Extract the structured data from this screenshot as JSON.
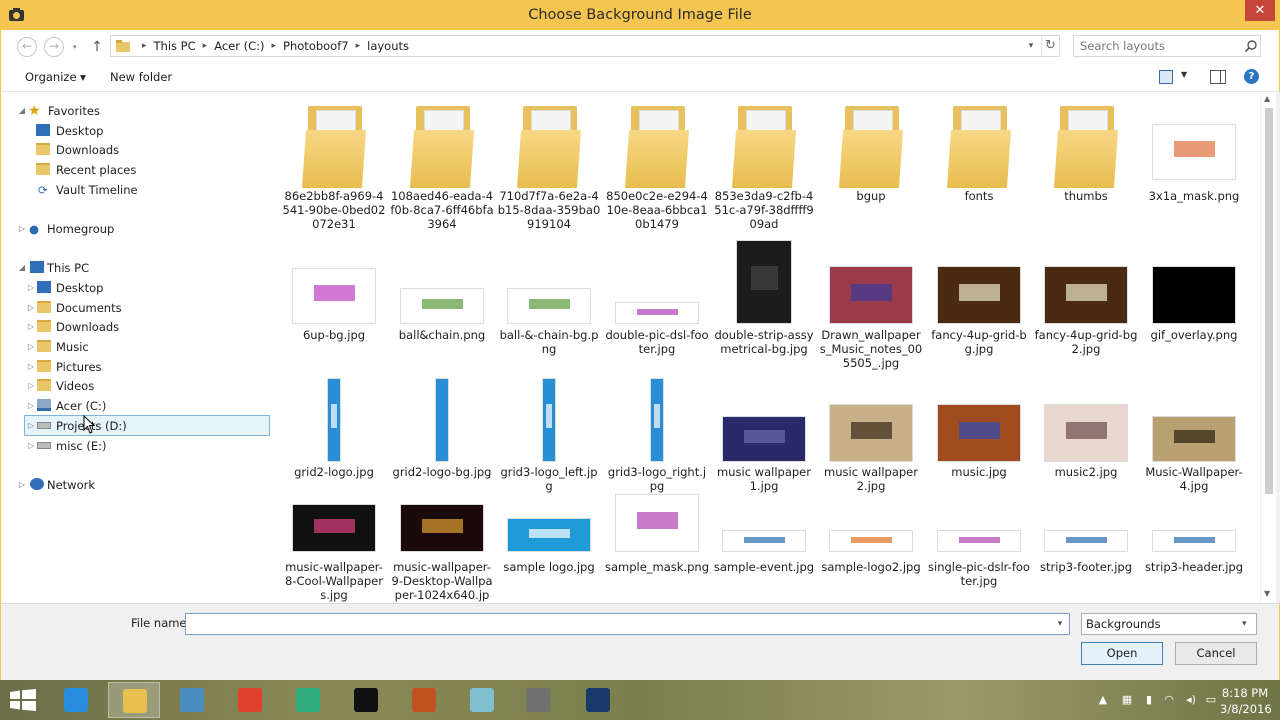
{
  "window": {
    "title": "Choose Background Image File",
    "close_symbol": "✕"
  },
  "address": {
    "crumbs": [
      "This PC",
      "Acer (C:)",
      "Photoboof7",
      "layouts"
    ]
  },
  "search": {
    "placeholder": "Search layouts"
  },
  "toolbar": {
    "organize_label": "Organize ▾",
    "new_folder_label": "New folder"
  },
  "nav": {
    "favorites": {
      "label": "Favorites",
      "items": [
        "Desktop",
        "Downloads",
        "Recent places",
        "Vault Timeline"
      ]
    },
    "homegroup": "Homegroup",
    "this_pc": {
      "label": "This PC",
      "items": [
        "Desktop",
        "Documents",
        "Downloads",
        "Music",
        "Pictures",
        "Videos",
        "Acer (C:)",
        "Projects (D:)",
        "misc (E:)"
      ]
    },
    "network": "Network"
  },
  "files": [
    {
      "name": "86e2bb8f-a969-4541-90be-0bed02072e31",
      "kind": "folder"
    },
    {
      "name": "108aed46-eada-4f0b-8ca7-6ff46bfa3964",
      "kind": "folder"
    },
    {
      "name": "710d7f7a-6e2a-4b15-8daa-359ba0919104",
      "kind": "folder"
    },
    {
      "name": "850e0c2e-e294-410e-8eaa-6bbca10b1479",
      "kind": "folder"
    },
    {
      "name": "853e3da9-c2fb-451c-a79f-38dffff909ad",
      "kind": "folder"
    },
    {
      "name": "bgup",
      "kind": "folder"
    },
    {
      "name": "fonts",
      "kind": "folder"
    },
    {
      "name": "thumbs",
      "kind": "folder"
    },
    {
      "name": "3x1a_mask.png",
      "kind": "image",
      "color": "#ffffff",
      "accent": "#e0703a"
    },
    {
      "name": "6up-bg.jpg",
      "kind": "image",
      "color": "#ffffff",
      "accent": "#c040c0"
    },
    {
      "name": "ball&chain.png",
      "kind": "image",
      "color": "#ffffff",
      "accent": "#5a9a3a"
    },
    {
      "name": "ball-&-chain-bg.png",
      "kind": "image",
      "color": "#ffffff",
      "accent": "#5a9a3a"
    },
    {
      "name": "double-pic-dsl-footer.jpg",
      "kind": "image",
      "color": "#ffffff",
      "accent": "#b040b0"
    },
    {
      "name": "double-strip-assymetrical-bg.jpg",
      "kind": "image",
      "color": "#1c1c1c",
      "accent": "#444444"
    },
    {
      "name": "Drawn_wallpapers_Music_notes_005505_.jpg",
      "kind": "image",
      "color": "#9a3a4a",
      "accent": "#3a3a9a"
    },
    {
      "name": "fancy-4up-grid-bg.jpg",
      "kind": "image",
      "color": "#4a2a12",
      "accent": "#f0e8d0"
    },
    {
      "name": "fancy-4up-grid-bg2.jpg",
      "kind": "image",
      "color": "#4a2a12",
      "accent": "#f0e8d0"
    },
    {
      "name": "gif_overlay.png",
      "kind": "image",
      "color": "#000000",
      "accent": "#000000"
    },
    {
      "name": "grid2-logo.jpg",
      "kind": "image",
      "color": "#2a8ed6",
      "accent": "#ffffff"
    },
    {
      "name": "grid2-logo-bg.jpg",
      "kind": "image",
      "color": "#2a8ed6",
      "accent": "#2a8ed6"
    },
    {
      "name": "grid3-logo_left.jpg",
      "kind": "image",
      "color": "#2a8ed6",
      "accent": "#ffffff"
    },
    {
      "name": "grid3-logo_right.jpg",
      "kind": "image",
      "color": "#2a8ed6",
      "accent": "#ffffff"
    },
    {
      "name": "music wallpaper 1.jpg",
      "kind": "image",
      "color": "#2a2a6a",
      "accent": "#6a6ab0"
    },
    {
      "name": "music wallpaper 2.jpg",
      "kind": "image",
      "color": "#c8b088",
      "accent": "#3a2a1a"
    },
    {
      "name": "music.jpg",
      "kind": "image",
      "color": "#a04a20",
      "accent": "#2a4ab0"
    },
    {
      "name": "music2.jpg",
      "kind": "image",
      "color": "#e8d8d0",
      "accent": "#6a4a4a"
    },
    {
      "name": "Music-Wallpaper-4.jpg",
      "kind": "image",
      "color": "#b8a070",
      "accent": "#2a2010"
    },
    {
      "name": "music-wallpaper-8-Cool-Wallpapers.jpg",
      "kind": "image",
      "color": "#101010",
      "accent": "#e04080"
    },
    {
      "name": "music-wallpaper-9-Desktop-Wallpaper-1024x640.jp",
      "kind": "image",
      "color": "#1a0a0a",
      "accent": "#e0a030"
    },
    {
      "name": "sample logo.jpg",
      "kind": "image",
      "color": "#1e9ad6",
      "accent": "#ffffff"
    },
    {
      "name": "sample_mask.png",
      "kind": "image",
      "color": "#ffffff",
      "accent": "#b040b0"
    },
    {
      "name": "sample-event.jpg",
      "kind": "image",
      "color": "#ffffff",
      "accent": "#2a6ab0"
    },
    {
      "name": "sample-logo2.jpg",
      "kind": "image",
      "color": "#ffffff",
      "accent": "#e07020"
    },
    {
      "name": "single-pic-dslr-footer.jpg",
      "kind": "image",
      "color": "#ffffff",
      "accent": "#b040b0"
    },
    {
      "name": "strip3-footer.jpg",
      "kind": "image",
      "color": "#ffffff",
      "accent": "#2a6ab0"
    },
    {
      "name": "strip3-header.jpg",
      "kind": "image",
      "color": "#ffffff",
      "accent": "#2a6ab0"
    }
  ],
  "bottom": {
    "file_name_label": "File name:",
    "file_name_value": "",
    "file_type": "Backgrounds",
    "open_label": "Open",
    "cancel_label": "Cancel"
  },
  "taskbar": {
    "apps": [
      {
        "name": "internet-explorer",
        "color": "#2a8ee0"
      },
      {
        "name": "file-explorer",
        "color": "#e8c050",
        "active": true
      },
      {
        "name": "explorer-2",
        "color": "#4a8ec0"
      },
      {
        "name": "chrome",
        "color": "#e04030"
      },
      {
        "name": "xodo",
        "color": "#30b080"
      },
      {
        "name": "command-prompt",
        "color": "#101010"
      },
      {
        "name": "quill",
        "color": "#c05020"
      },
      {
        "name": "notes",
        "color": "#80c0d0"
      },
      {
        "name": "camera",
        "color": "#707070"
      },
      {
        "name": "screen-recorder",
        "color": "#1a3a6a"
      }
    ],
    "time": "8:18 PM",
    "date": "3/8/2016"
  },
  "colors": {
    "title_bar": "#f4c54f",
    "selection": "#e5f3fb",
    "accent_blue": "#2a8ed6"
  }
}
